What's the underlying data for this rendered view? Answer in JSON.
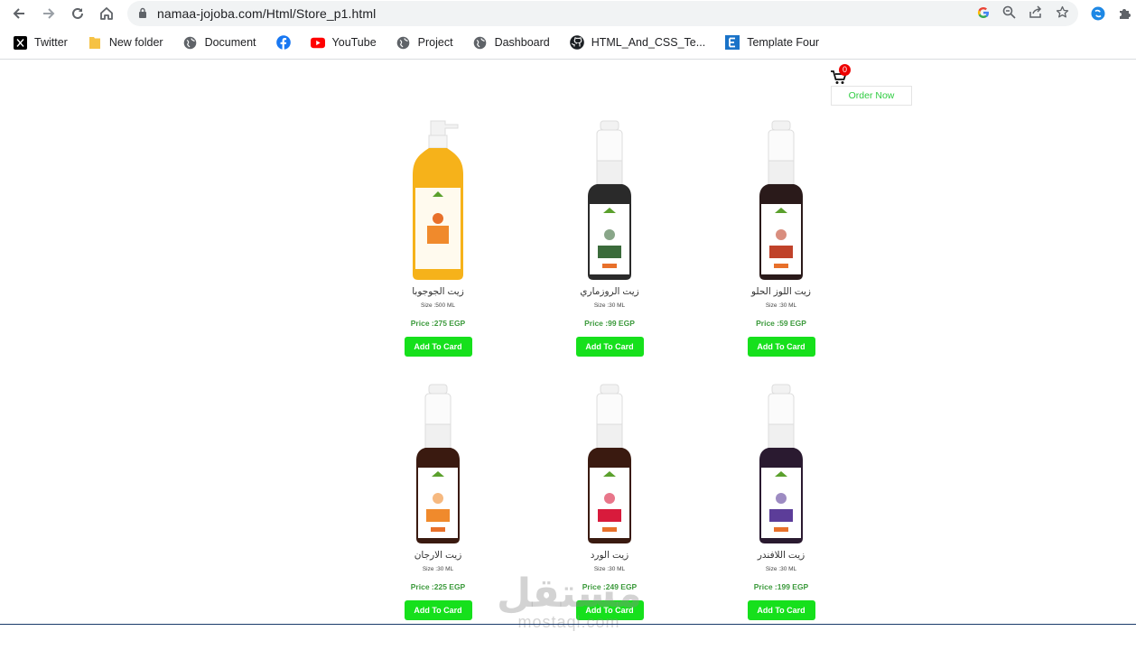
{
  "browser": {
    "url": "namaa-jojoba.com/Html/Store_p1.html",
    "bookmarks": [
      {
        "label": "Twitter",
        "icon": "x-twitter-icon"
      },
      {
        "label": "New folder",
        "icon": "folder-icon"
      },
      {
        "label": "Document",
        "icon": "globe-icon"
      },
      {
        "label": "",
        "icon": "facebook-icon"
      },
      {
        "label": "YouTube",
        "icon": "youtube-icon"
      },
      {
        "label": "Project",
        "icon": "globe-icon"
      },
      {
        "label": "Dashboard",
        "icon": "globe-icon"
      },
      {
        "label": "HTML_And_CSS_Te...",
        "icon": "github-icon"
      },
      {
        "label": "Template Four",
        "icon": "e-letter-icon"
      }
    ]
  },
  "header": {
    "cart_count": "0",
    "order_label": "Order Now"
  },
  "products": [
    {
      "name": "زيت الجوجوبا",
      "size": "Size :500 ML",
      "price": "Price :275 EGP",
      "button": "Add To Card",
      "label_color": "#f08a2c",
      "fill_color": "#f6b21a"
    },
    {
      "name": "زيت الروزماري",
      "size": "Size :30 ML",
      "price": "Price :99 EGP",
      "button": "Add To Card",
      "label_color": "#3b6b3b",
      "fill_color": "#2a2a2a"
    },
    {
      "name": "زيت اللوز الحلو",
      "size": "Size :30 ML",
      "price": "Price :59 EGP",
      "button": "Add To Card",
      "label_color": "#c0422a",
      "fill_color": "#2a1a1a"
    },
    {
      "name": "زيت الارجان",
      "size": "Size :30 ML",
      "price": "Price :225 EGP",
      "button": "Add To Card",
      "label_color": "#f08a2c",
      "fill_color": "#3a1a10"
    },
    {
      "name": "زيت الورد",
      "size": "Size :30 ML",
      "price": "Price :249 EGP",
      "button": "Add To Card",
      "label_color": "#d81b3c",
      "fill_color": "#3a1a10"
    },
    {
      "name": "زيت اللافندر",
      "size": "Size :30 ML",
      "price": "Price :199 EGP",
      "button": "Add To Card",
      "label_color": "#5c3d99",
      "fill_color": "#2a1a30"
    }
  ],
  "watermark": {
    "arabic": "مستقل",
    "latin": "mostaql.com"
  }
}
